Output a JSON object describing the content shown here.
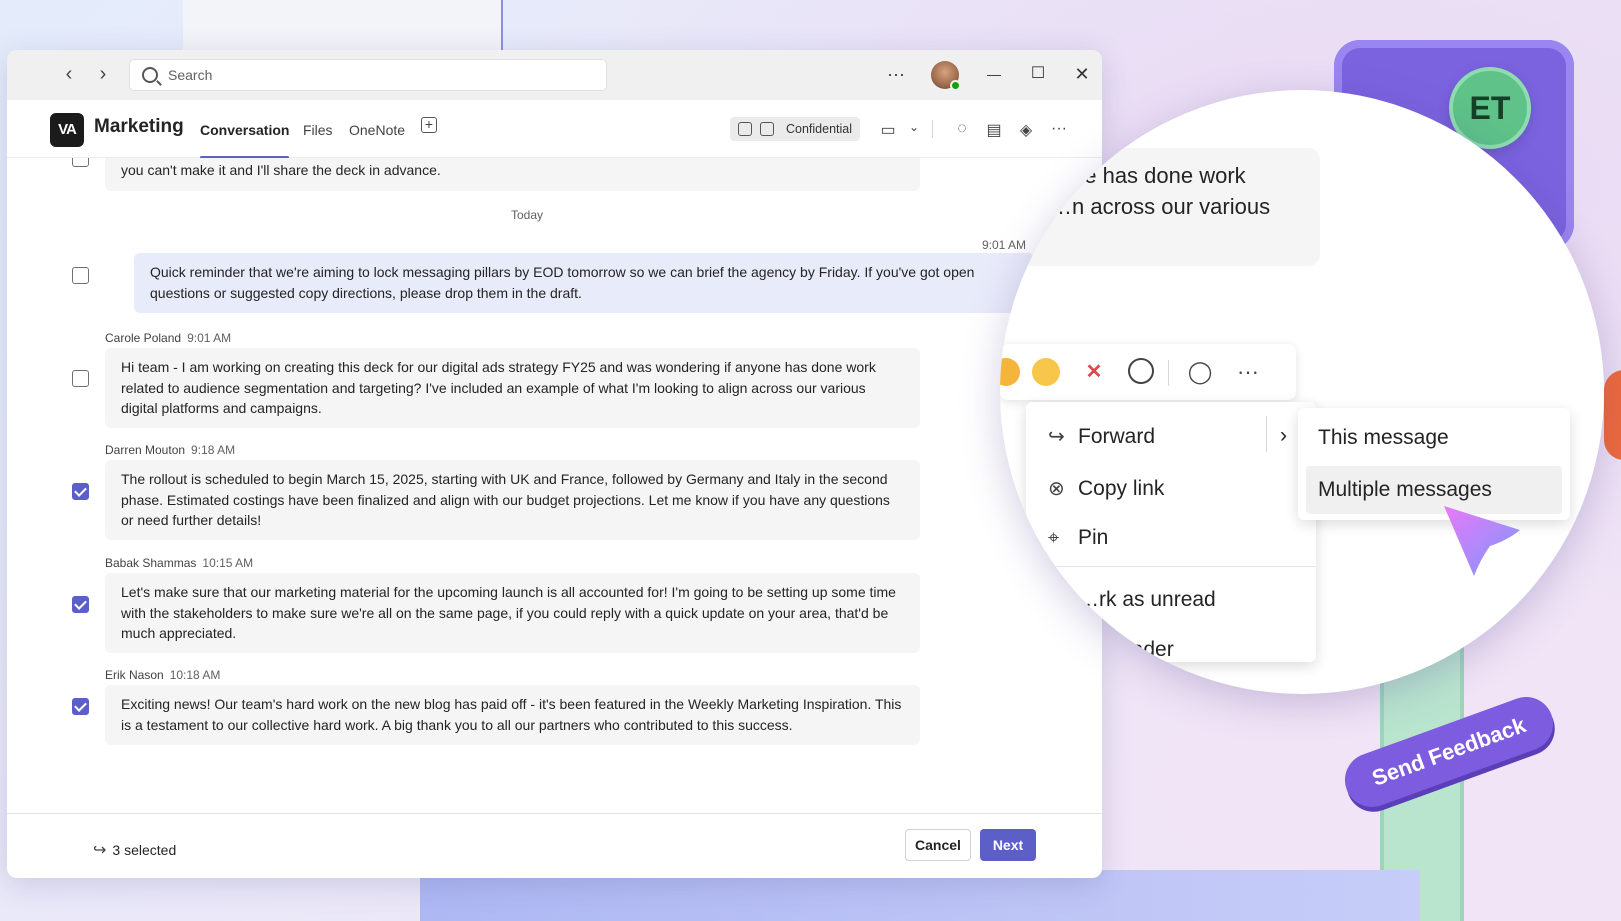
{
  "window": {
    "search_placeholder": "Search",
    "more_label": "···",
    "minimize": "—",
    "maximize": "☐",
    "close": "✕"
  },
  "channel": {
    "logo_text": "VA",
    "name": "Marketing",
    "tabs": [
      {
        "label": "Conversation",
        "active": true
      },
      {
        "label": "Files",
        "active": false
      },
      {
        "label": "OneNote",
        "active": false
      }
    ],
    "add_tab": "+",
    "sensitivity_label": "Confidential"
  },
  "messages": {
    "partial_text": "you can't make it and I'll share the deck in advance.",
    "date_divider": "Today",
    "mine": {
      "time": "9:01 AM",
      "text": "Quick reminder that we're aiming to lock messaging pillars by EOD tomorrow so we can brief the agency by Friday. If you've got open questions or suggested copy directions, please drop them in the draft.",
      "checked": false
    },
    "items": [
      {
        "author": "Carole Poland",
        "time": "9:01 AM",
        "text": "Hi team - I am working on creating this deck for our digital ads strategy FY25 and was wondering if anyone has done work related to audience segmentation and targeting? I've included an example of what I'm looking to align across our various digital platforms and campaigns.",
        "checked": false
      },
      {
        "author": "Darren Mouton",
        "time": "9:18 AM",
        "text": "The rollout is scheduled to begin March 15, 2025, starting with UK and France, followed by Germany and Italy in the second phase. Estimated costings have been finalized and align with our budget projections. Let me know if you have any questions or need further details!",
        "checked": true
      },
      {
        "author": "Babak Shammas",
        "time": "10:15 AM",
        "text": "Let's make sure that our marketing material for the upcoming launch is all accounted for! I'm going to be setting up some time with the stakeholders to make sure we're all on the same page, if you could reply with a quick update on your area, that'd be much appreciated.",
        "checked": true
      },
      {
        "author": "Erik Nason",
        "time": "10:18 AM",
        "text": "Exciting news! Our team's hard work on the new blog has paid off - it's been featured in the Weekly Marketing Inspiration. This is a testament to our collective hard work. A big thank you to all our partners who contributed to this success.",
        "checked": true
      }
    ]
  },
  "footer": {
    "selected_text": "3 selected",
    "cancel_label": "Cancel",
    "next_label": "Next"
  },
  "magnified": {
    "fragment_line1": "…ne has done work",
    "fragment_line2": "…n across our various",
    "menu": {
      "forward": "Forward",
      "copy_link": "Copy link",
      "pin": "Pin",
      "mark_unread": "…rk as unread",
      "reader": "… Reader"
    },
    "submenu": {
      "this_message": "This message",
      "multiple_messages": "Multiple messages"
    }
  },
  "badge_initials": "ET",
  "feedback_label": "Send Feedback",
  "colors": {
    "brand": "#5b5fc7",
    "own_bubble": "#e8ebfa",
    "other_bubble": "#f5f5f5"
  }
}
